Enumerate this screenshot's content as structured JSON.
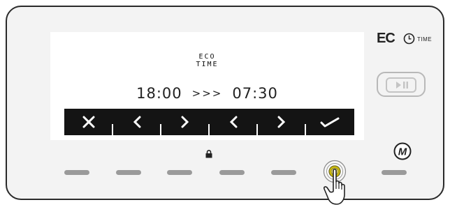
{
  "display": {
    "title_line1": "ECO",
    "title_line2": "TIME",
    "start_time": "18:00",
    "arrows": ">>>",
    "end_time": "07:30"
  },
  "soft_keys": [
    {
      "icon": "close-icon"
    },
    {
      "icon": "chevron-left-icon"
    },
    {
      "icon": "chevron-right-icon"
    },
    {
      "icon": "chevron-left-icon"
    },
    {
      "icon": "chevron-right-icon"
    },
    {
      "icon": "check-icon"
    }
  ],
  "brand": {
    "eco": "EC",
    "time": "TIME"
  },
  "mode_button": {
    "label": "M"
  },
  "colors": {
    "panel": "#f3f3f3",
    "screen": "#ffffff",
    "bar": "#141414",
    "key": "#9a9a9a",
    "accent_press": "#d6c200"
  }
}
